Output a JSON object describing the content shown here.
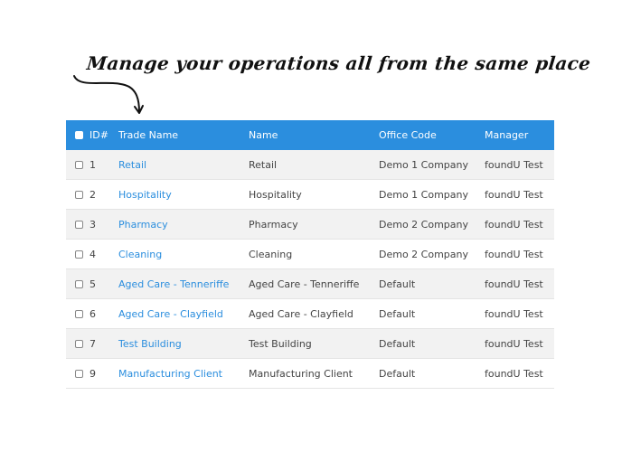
{
  "headline": "Manage your operations all from the same place",
  "colors": {
    "header_bg": "#2b8ede",
    "link": "#2b8ede",
    "row_alt": "#f2f2f2"
  },
  "table": {
    "columns": [
      "ID#",
      "Trade Name",
      "Name",
      "Office Code",
      "Manager"
    ],
    "rows": [
      {
        "id": "1",
        "trade_name": "Retail",
        "name": "Retail",
        "office_code": "Demo 1 Company",
        "manager": "foundU Test"
      },
      {
        "id": "2",
        "trade_name": "Hospitality",
        "name": "Hospitality",
        "office_code": "Demo 1 Company",
        "manager": "foundU Test"
      },
      {
        "id": "3",
        "trade_name": "Pharmacy",
        "name": "Pharmacy",
        "office_code": "Demo 2 Company",
        "manager": "foundU Test"
      },
      {
        "id": "4",
        "trade_name": "Cleaning",
        "name": "Cleaning",
        "office_code": "Demo 2 Company",
        "manager": "foundU Test"
      },
      {
        "id": "5",
        "trade_name": "Aged Care - Tenneriffe",
        "name": "Aged Care - Tenneriffe",
        "office_code": "Default",
        "manager": "foundU Test"
      },
      {
        "id": "6",
        "trade_name": "Aged Care - Clayfield",
        "name": "Aged Care - Clayfield",
        "office_code": "Default",
        "manager": "foundU Test"
      },
      {
        "id": "7",
        "trade_name": "Test Building",
        "name": "Test Building",
        "office_code": "Default",
        "manager": "foundU Test"
      },
      {
        "id": "9",
        "trade_name": "Manufacturing Client",
        "name": "Manufacturing Client",
        "office_code": "Default",
        "manager": "foundU Test"
      }
    ]
  }
}
